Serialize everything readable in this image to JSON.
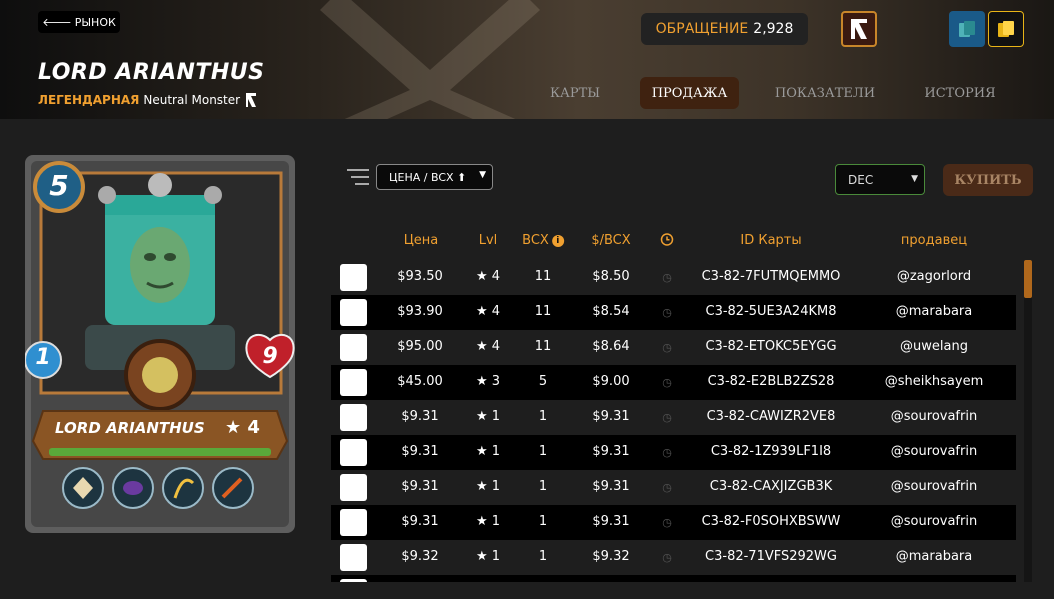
{
  "header": {
    "back_label": "РЫНОК",
    "card_name": "LORD ARIANTHUS",
    "rarity": "ЛЕГЕНДАРНАЯ",
    "subtitle": "Neutral Monster",
    "circulation_label": "ОБРАЩЕНИЕ",
    "circulation_value": "2,928",
    "tabs": [
      {
        "label": "КАРТЫ",
        "active": false
      },
      {
        "label": "ПРОДАЖА",
        "active": true
      },
      {
        "label": "ПОКАЗАТЕЛИ",
        "active": false
      },
      {
        "label": "ИСТОРИЯ",
        "active": false
      }
    ]
  },
  "card": {
    "mana": "5",
    "attack": "1",
    "health": "9",
    "name": "LORD ARIANTHUS",
    "level": "★ 4",
    "ability_icons": [
      "reflect-icon",
      "void-icon",
      "shield-icon",
      "weapon-icon"
    ]
  },
  "controls": {
    "sort_label": "ЦЕНА / BCX ⬆",
    "currency": "DEC",
    "buy_label": "КУПИТЬ"
  },
  "table": {
    "headers": {
      "price": "Цена",
      "lvl": "Lvl",
      "bcx": "BCX",
      "per_bcx": "$/BCX",
      "card_id": "ID Карты",
      "seller": "продавец"
    },
    "rows": [
      {
        "price": "$93.50",
        "lvl": "★ 4",
        "bcx": "11",
        "per_bcx": "$8.50",
        "card_id": "C3-82-7FUTMQEMMO",
        "seller": "@zagorlord"
      },
      {
        "price": "$93.90",
        "lvl": "★ 4",
        "bcx": "11",
        "per_bcx": "$8.54",
        "card_id": "C3-82-5UE3A24KM8",
        "seller": "@marabara"
      },
      {
        "price": "$95.00",
        "lvl": "★ 4",
        "bcx": "11",
        "per_bcx": "$8.64",
        "card_id": "C3-82-ETOKC5EYGG",
        "seller": "@uwelang"
      },
      {
        "price": "$45.00",
        "lvl": "★ 3",
        "bcx": "5",
        "per_bcx": "$9.00",
        "card_id": "C3-82-E2BLB2ZS28",
        "seller": "@sheikhsayem"
      },
      {
        "price": "$9.31",
        "lvl": "★ 1",
        "bcx": "1",
        "per_bcx": "$9.31",
        "card_id": "C3-82-CAWIZR2VE8",
        "seller": "@sourovafrin"
      },
      {
        "price": "$9.31",
        "lvl": "★ 1",
        "bcx": "1",
        "per_bcx": "$9.31",
        "card_id": "C3-82-1Z939LF1I8",
        "seller": "@sourovafrin"
      },
      {
        "price": "$9.31",
        "lvl": "★ 1",
        "bcx": "1",
        "per_bcx": "$9.31",
        "card_id": "C3-82-CAXJIZGB3K",
        "seller": "@sourovafrin"
      },
      {
        "price": "$9.31",
        "lvl": "★ 1",
        "bcx": "1",
        "per_bcx": "$9.31",
        "card_id": "C3-82-F0SOHXBSWW",
        "seller": "@sourovafrin"
      },
      {
        "price": "$9.32",
        "lvl": "★ 1",
        "bcx": "1",
        "per_bcx": "$9.32",
        "card_id": "C3-82-71VFS292WG",
        "seller": "@marabara"
      },
      {
        "price": "",
        "lvl": "",
        "bcx": "",
        "per_bcx": "",
        "card_id": "",
        "seller": ""
      }
    ]
  },
  "colors": {
    "accent": "#f0a030",
    "active_tab": "#3f2210",
    "buy_button": "#4a2a18"
  }
}
